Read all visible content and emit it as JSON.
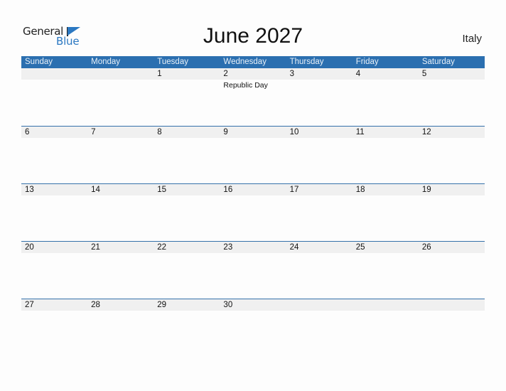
{
  "logo": {
    "line1": "General",
    "line2": "Blue",
    "accent_color": "#2b78c2"
  },
  "header": {
    "title": "June 2027",
    "country": "Italy"
  },
  "calendar": {
    "header_color": "#2b6fb0",
    "weekdays": [
      "Sunday",
      "Monday",
      "Tuesday",
      "Wednesday",
      "Thursday",
      "Friday",
      "Saturday"
    ],
    "weeks": [
      {
        "days": [
          "",
          "",
          "1",
          "2",
          "3",
          "4",
          "5"
        ],
        "events": [
          "",
          "",
          "",
          "Republic Day",
          "",
          "",
          ""
        ]
      },
      {
        "days": [
          "6",
          "7",
          "8",
          "9",
          "10",
          "11",
          "12"
        ],
        "events": [
          "",
          "",
          "",
          "",
          "",
          "",
          ""
        ]
      },
      {
        "days": [
          "13",
          "14",
          "15",
          "16",
          "17",
          "18",
          "19"
        ],
        "events": [
          "",
          "",
          "",
          "",
          "",
          "",
          ""
        ]
      },
      {
        "days": [
          "20",
          "21",
          "22",
          "23",
          "24",
          "25",
          "26"
        ],
        "events": [
          "",
          "",
          "",
          "",
          "",
          "",
          ""
        ]
      },
      {
        "days": [
          "27",
          "28",
          "29",
          "30",
          "",
          "",
          ""
        ],
        "events": [
          "",
          "",
          "",
          "",
          "",
          "",
          ""
        ]
      }
    ]
  }
}
